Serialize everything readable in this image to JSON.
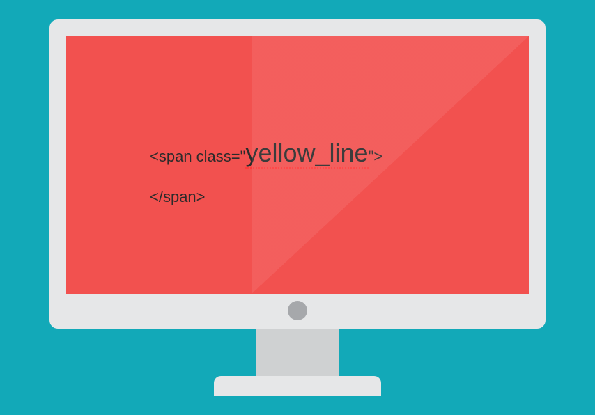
{
  "code": {
    "line1_prefix": "<span class=\"",
    "line1_classname": "yellow_line",
    "line1_suffix": "\">",
    "line2": "</span>"
  }
}
